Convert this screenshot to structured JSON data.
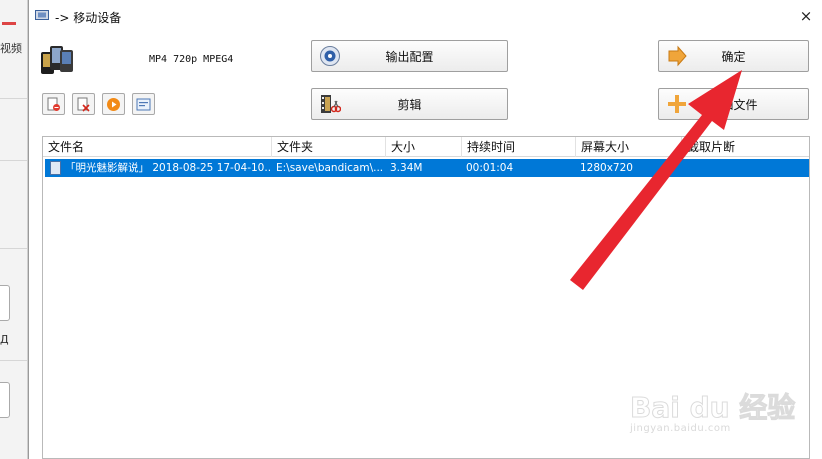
{
  "background": {
    "side_label": "视频",
    "side_letter": "Д"
  },
  "dialog": {
    "title": "-> 移动设备",
    "close_glyph": "×",
    "profile_text": "MP4 720p MPEG4",
    "buttons": {
      "output_config": "输出配置",
      "clip": "剪辑",
      "confirm": "确定",
      "add_file": "添加文件"
    },
    "toolbar_icons": [
      "remove-file-icon",
      "clear-list-icon",
      "play-icon",
      "media-info-icon"
    ]
  },
  "table": {
    "headers": [
      "文件名",
      "文件夹",
      "大小",
      "持续时间",
      "屏幕大小",
      "截取片断"
    ],
    "rows": [
      {
        "name": "「明光魅影解说」 2018-08-25 17-04-10...",
        "folder": "E:\\save\\bandicam\\...",
        "size": "3.34M",
        "duration": "00:01:04",
        "screen": "1280x720",
        "clip": ""
      }
    ]
  },
  "watermark": {
    "main": "Bai du 经验",
    "sub": "jingyan.baidu.com"
  },
  "colors": {
    "selection": "#0078d7",
    "annotation_arrow": "#e8262f"
  }
}
